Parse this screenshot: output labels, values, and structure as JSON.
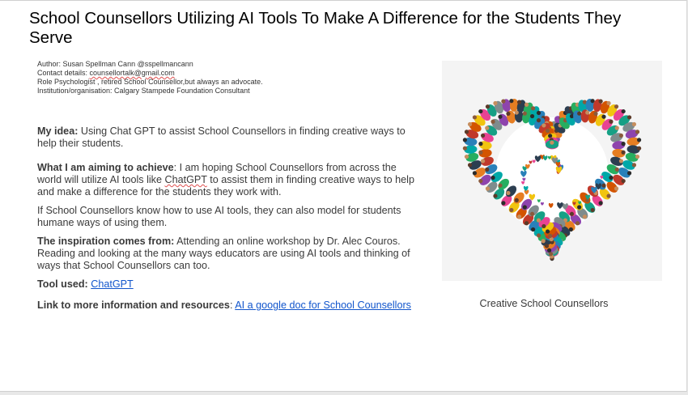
{
  "title": "School Counsellors Utilizing AI Tools To Make A Difference for the Students They Serve",
  "meta": {
    "author": "Author: Susan Spellman Cann @sspellmancann",
    "contact_prefix": "Contact details: ",
    "contact_email": "counsellortalk@gmail.com",
    "role": "Role Psychologist , retired School Counsellor,but always an advocate.",
    "institution": "Institution/organisation: Calgary Stampede Foundation Consultant"
  },
  "idea": {
    "label": "My idea:",
    "text": " Using Chat GPT to assist School Counsellors in finding creative ways to help their students."
  },
  "aim": {
    "label": "What I am aiming to achieve",
    "text_before": ": I am hoping School Counsellors from across the world will utilize AI tools like ",
    "chatgpt": "ChatGPT",
    "text_after": " to assist them in finding creative ways to help and make a difference for the students they work with."
  },
  "if_text": "If School Counsellors know how to use AI tools, they can also model for students humane ways of using them.",
  "inspiration": {
    "label": "The inspiration comes from:",
    "text": " Attending an online workshop by Dr. Alec Couros. Reading and looking at the many ways educators are using AI tools and thinking of ways that School Counsellors can too."
  },
  "tool": {
    "label": "Tool used:",
    "link": "ChatGPT"
  },
  "link_more": {
    "label": "Link to more information and resources",
    "sep": ": ",
    "link": "AI a google doc for School Counsellors"
  },
  "image": {
    "caption": "Creative School Counsellors",
    "colors": [
      "#c0392b",
      "#e67e22",
      "#f1c40f",
      "#27ae60",
      "#16a085",
      "#2980b9",
      "#8e44ad",
      "#d35400",
      "#2c3e50",
      "#e84393",
      "#00a8a8",
      "#7f8c8d"
    ]
  }
}
